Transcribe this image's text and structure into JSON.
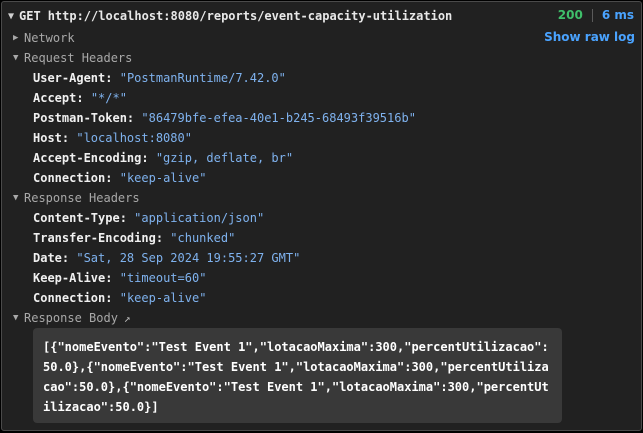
{
  "request": {
    "caret": "▼",
    "method": "GET",
    "url": "http://localhost:8080/reports/event-capacity-utilization",
    "status": "200",
    "time": "6 ms"
  },
  "show_raw_log": "Show raw log",
  "network": {
    "toggle": "▶",
    "label": "Network"
  },
  "request_headers": {
    "toggle": "▼",
    "label": "Request Headers",
    "items": [
      {
        "key": "User-Agent:",
        "value": "\"PostmanRuntime/7.42.0\""
      },
      {
        "key": "Accept:",
        "value": "\"*/*\""
      },
      {
        "key": "Postman-Token:",
        "value": "\"86479bfe-efea-40e1-b245-68493f39516b\""
      },
      {
        "key": "Host:",
        "value": "\"localhost:8080\""
      },
      {
        "key": "Accept-Encoding:",
        "value": "\"gzip, deflate, br\""
      },
      {
        "key": "Connection:",
        "value": "\"keep-alive\""
      }
    ]
  },
  "response_headers": {
    "toggle": "▼",
    "label": "Response Headers",
    "items": [
      {
        "key": "Content-Type:",
        "value": "\"application/json\""
      },
      {
        "key": "Transfer-Encoding:",
        "value": "\"chunked\""
      },
      {
        "key": "Date:",
        "value": "\"Sat, 28 Sep 2024 19:55:27 GMT\""
      },
      {
        "key": "Keep-Alive:",
        "value": "\"timeout=60\""
      },
      {
        "key": "Connection:",
        "value": "\"keep-alive\""
      }
    ]
  },
  "response_body": {
    "toggle": "▼",
    "label": "Response Body",
    "ext_icon": "↗",
    "text": "[{\"nomeEvento\":\"Test Event 1\",\"lotacaoMaxima\":300,\"percentUtilizacao\":50.0},{\"nomeEvento\":\"Test Event 1\",\"lotacaoMaxima\":300,\"percentUtilizacao\":50.0},{\"nomeEvento\":\"Test Event 1\",\"lotacaoMaxima\":300,\"percentUtilizacao\":50.0}]"
  }
}
